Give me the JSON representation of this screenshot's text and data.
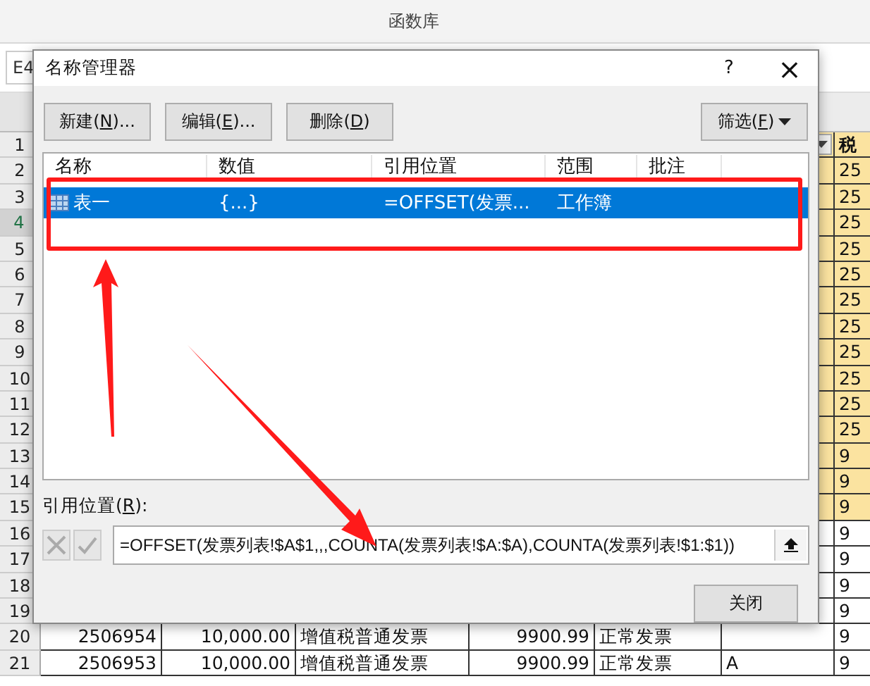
{
  "sheet": {
    "ribbon_group": "函数库",
    "name_box": "E4",
    "rows": [
      {
        "header": "1",
        "selected": false,
        "kind": "title",
        "last": "税",
        "highlight": true
      },
      {
        "header": "2",
        "selected": false,
        "kind": "plain",
        "last": "25",
        "highlight": true
      },
      {
        "header": "3",
        "selected": false,
        "kind": "plain",
        "last": "25",
        "highlight": true
      },
      {
        "header": "4",
        "selected": true,
        "kind": "plain",
        "last": "25",
        "highlight": true
      },
      {
        "header": "5",
        "selected": false,
        "kind": "plain",
        "last": "25",
        "highlight": true
      },
      {
        "header": "6",
        "selected": false,
        "kind": "plain",
        "last": "25",
        "highlight": true
      },
      {
        "header": "7",
        "selected": false,
        "kind": "plain",
        "last": "25",
        "highlight": true
      },
      {
        "header": "8",
        "selected": false,
        "kind": "plain",
        "last": "25",
        "highlight": true
      },
      {
        "header": "9",
        "selected": false,
        "kind": "plain",
        "last": "25",
        "highlight": true
      },
      {
        "header": "10",
        "selected": false,
        "kind": "plain",
        "last": "25",
        "highlight": true
      },
      {
        "header": "11",
        "selected": false,
        "kind": "plain",
        "last": "25",
        "highlight": true
      },
      {
        "header": "12",
        "selected": false,
        "kind": "plain",
        "last": "25",
        "highlight": true
      },
      {
        "header": "13",
        "selected": false,
        "kind": "plain",
        "last": "9",
        "highlight": true
      },
      {
        "header": "14",
        "selected": false,
        "kind": "plain",
        "last": "9",
        "highlight": true
      },
      {
        "header": "15",
        "selected": false,
        "kind": "plain",
        "last": "9",
        "highlight": true
      },
      {
        "header": "16",
        "selected": false,
        "kind": "plain",
        "last": "9",
        "highlight": false
      },
      {
        "header": "17",
        "selected": false,
        "kind": "plain",
        "last": "9",
        "highlight": false
      },
      {
        "header": "18",
        "selected": false,
        "kind": "plain",
        "last": "9",
        "highlight": false
      },
      {
        "header": "19",
        "selected": false,
        "kind": "plain",
        "last": "9",
        "highlight": false
      },
      {
        "header": "20",
        "selected": false,
        "kind": "data",
        "cells": [
          "2506954",
          "10,000.00",
          "增值税普通发票",
          "9900.99",
          "正常发票"
        ],
        "last": "9",
        "highlight": false
      },
      {
        "header": "21",
        "selected": false,
        "kind": "data",
        "cells": [
          "2506953",
          "10,000.00",
          "增值税普通发票",
          "9900.99",
          "正常发票",
          "A"
        ],
        "last": "9",
        "highlight": false
      }
    ]
  },
  "dialog": {
    "title": "名称管理器",
    "help": "?",
    "close": "×",
    "buttons": [
      {
        "before": "新建(",
        "key": "N",
        "after": ")..."
      },
      {
        "before": "编辑(",
        "key": "E",
        "after": ")..."
      },
      {
        "before": "删除(",
        "key": "D",
        "after": ")"
      }
    ],
    "filter": {
      "before": "筛选(",
      "key": "F",
      "after": ")"
    },
    "columns": [
      "名称",
      "数值",
      "引用位置",
      "范围",
      "批注"
    ],
    "names": [
      {
        "name": "表一",
        "value": "{...}",
        "refers_to": "=OFFSET(发票...",
        "scope": "工作簿",
        "selected": true
      }
    ],
    "refers_label": {
      "before": "引用位置(",
      "key": "R",
      "after": "):"
    },
    "formula": "=OFFSET(发票列表!$A$1,,,COUNTA(发票列表!$A:$A),COUNTA(发票列表!$1:$1))",
    "close_button": "关闭"
  }
}
